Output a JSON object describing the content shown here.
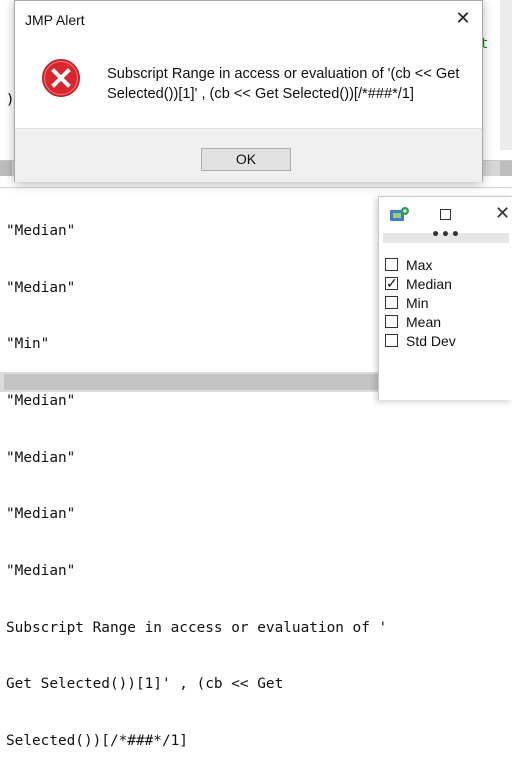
{
  "editor": {
    "fragment_right": "t",
    "fragment_left": ")"
  },
  "log": {
    "lines": [
      "\"Median\"",
      "\"Median\"",
      "\"Min\"",
      "\"Median\"",
      "\"Median\"",
      "\"Median\"",
      "\"Median\"",
      "Subscript Range in access or evaluation of '(cb << Get Selected())[1]' , (cb << Get",
      "Get Selected())[1]' , (cb << Get",
      "Selected())[/*###*/1]"
    ]
  },
  "palette": {
    "app_icon": "jmp-app-icon",
    "grip": "•••",
    "options": [
      {
        "label": "Max",
        "checked": false
      },
      {
        "label": "Median",
        "checked": true
      },
      {
        "label": "Min",
        "checked": false
      },
      {
        "label": "Mean",
        "checked": false
      },
      {
        "label": "Std Dev",
        "checked": false
      }
    ]
  },
  "alert": {
    "title": "JMP Alert",
    "close_symbol": "✕",
    "icon": "error-icon",
    "message_line1": "Subscript Range in access or evaluation of '(cb << Get",
    "message_line2": "Selected())[1]' , (cb << Get Selected())[/*###*/1]",
    "ok_label": "OK"
  },
  "colors": {
    "error_red": "#d9262c",
    "code_green": "#1a8a1a"
  }
}
